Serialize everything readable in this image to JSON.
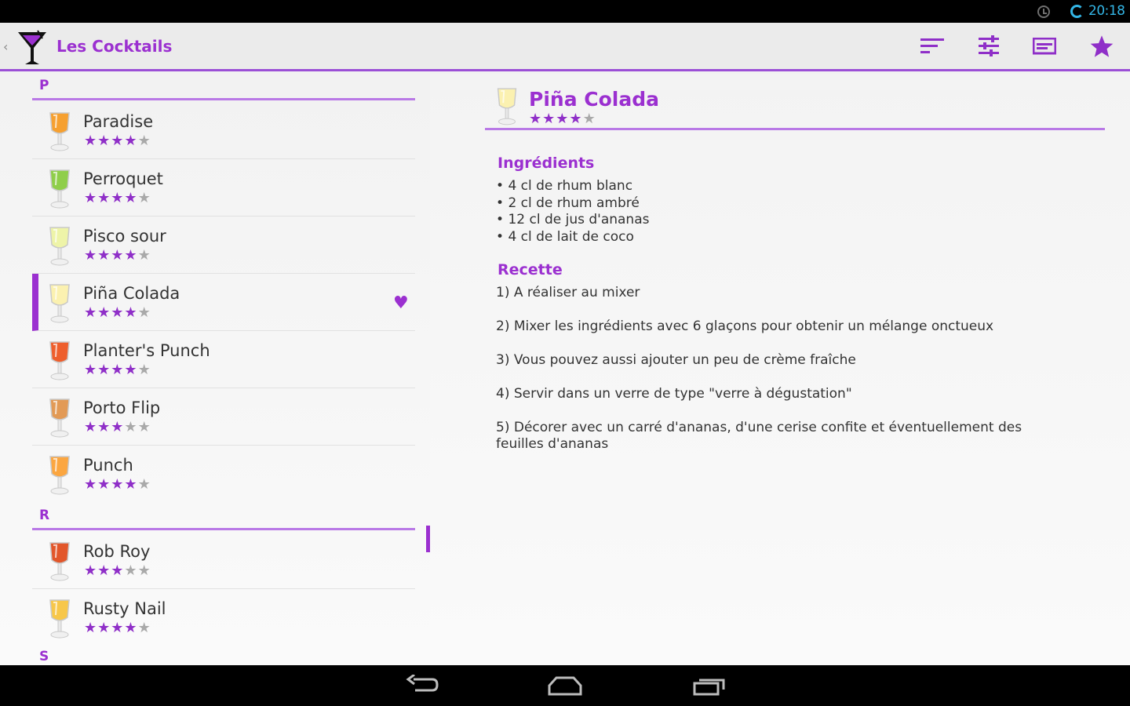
{
  "status_bar": {
    "time": "20:18"
  },
  "action_bar": {
    "title": "Les Cocktails",
    "icons": [
      "back-caret-icon",
      "martini-glass-icon",
      "sort-icon",
      "filter-sliders-icon",
      "card-view-icon",
      "star-favorites-icon"
    ]
  },
  "list": {
    "sections": [
      {
        "letter": "P"
      },
      {
        "letter": "R"
      },
      {
        "letter": "S"
      }
    ],
    "items": [
      {
        "name": "Paradise",
        "rating": 4,
        "glass_color": "#f6a030"
      },
      {
        "name": "Perroquet",
        "rating": 4,
        "glass_color": "#8fce4a"
      },
      {
        "name": "Pisco sour",
        "rating": 4,
        "glass_color": "#eef4a8"
      },
      {
        "name": "Piña Colada",
        "rating": 4,
        "glass_color": "#fbf1b0",
        "favorite": true,
        "selected": true
      },
      {
        "name": "Planter's Punch",
        "rating": 4,
        "glass_color": "#ee5e2c"
      },
      {
        "name": "Porto Flip",
        "rating": 3,
        "glass_color": "#e29a56"
      },
      {
        "name": "Punch",
        "rating": 4,
        "glass_color": "#fba640"
      },
      {
        "name": "Rob Roy",
        "rating": 3,
        "glass_color": "#e2562a"
      },
      {
        "name": "Rusty Nail",
        "rating": 4,
        "glass_color": "#f7c74a"
      }
    ]
  },
  "detail": {
    "title": "Piña Colada",
    "rating": 4,
    "ingredients_title": "Ingrédients",
    "ingredients": [
      "4 cl de rhum blanc",
      "2 cl de rhum ambré",
      "12 cl de jus d'ananas",
      "4 cl de lait de coco"
    ],
    "recipe_title": "Recette",
    "steps": [
      "1) A réaliser au mixer",
      "2) Mixer les ingrédients avec 6 glaçons pour obtenir un mélange onctueux",
      "3) Vous pouvez aussi ajouter un peu de crème fraîche",
      "4) Servir dans un verre de type \"verre à dégustation\"",
      "5) Décorer avec un carré d'ananas, d'une cerise confite et éventuellement des feuilles d'ananas"
    ]
  },
  "nav_bar": {
    "icons": [
      "back-arrow-icon",
      "home-icon",
      "recent-apps-icon"
    ]
  },
  "colors": {
    "accent": "#9b30d0",
    "accent_light": "#b979e6",
    "star_off": "#a9a9a9"
  }
}
